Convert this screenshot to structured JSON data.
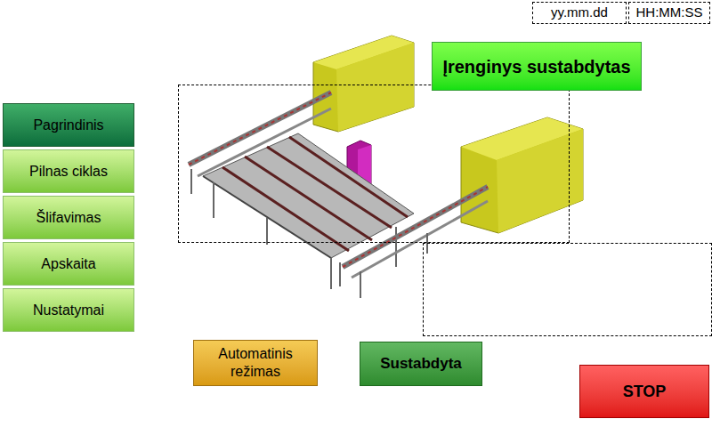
{
  "datetime": {
    "date": "yy.mm.dd",
    "time": "HH:MM:SS"
  },
  "status_banner": {
    "text": "Įrenginys sustabdytas"
  },
  "nav": {
    "items": [
      {
        "label": "Pagrindinis",
        "selected": true
      },
      {
        "label": "Pilnas ciklas",
        "selected": false
      },
      {
        "label": "Šlifavimas",
        "selected": false
      },
      {
        "label": "Apskaita",
        "selected": false
      },
      {
        "label": "Nustatymai",
        "selected": false
      }
    ]
  },
  "mode_button": {
    "label": "Automatinis režimas"
  },
  "state_button": {
    "label": "Sustabdyta"
  },
  "stop_button": {
    "label": "STOP"
  }
}
